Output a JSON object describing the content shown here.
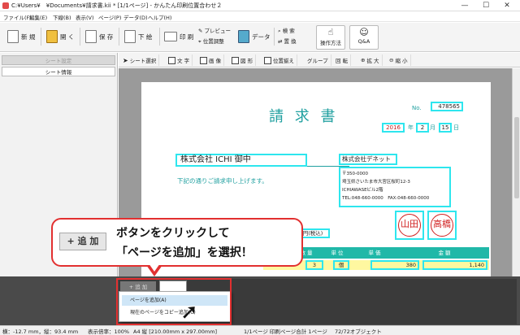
{
  "window": {
    "title": "C:¥Users¥　¥Documents¥請求書.kii * [1/1ページ] - かんたん印刷位置合わせ２",
    "controls": [
      "—",
      "☐",
      "✕"
    ]
  },
  "menu": [
    "ファイル(F)",
    "編集(E)",
    "下線(B)",
    "表示(V)",
    "ページ(P)",
    "データ(D)",
    "ヘルプ(H)"
  ],
  "toolbar": {
    "new": "新 規",
    "open": "開 く",
    "save": "保 存",
    "import": "下 絵",
    "print": "印 刷",
    "preview": "プレビュー",
    "position": "位置調整",
    "data": "データ",
    "search": "検 索",
    "replace": "置 換",
    "howto": "操作方法",
    "qa": "Q&A"
  },
  "leftPanel": {
    "tabs": [
      "シート設定",
      "シート情報"
    ]
  },
  "toolbar2": [
    "シート選択",
    "文 字",
    "画 像",
    "図 形",
    "位置揃え",
    "グループ",
    "回 転",
    "拡 大",
    "縮 小"
  ],
  "document": {
    "title": "請 求 書",
    "no_label": "No.",
    "no_value": "478565",
    "year": "2016",
    "year_unit": "年",
    "month": "2",
    "month_unit": "月",
    "day": "15",
    "day_unit": "日",
    "customer": "株式会社 ICHI 御中",
    "subtext": "下記の通りご請求申し上げます。",
    "company": "株式会社デネット",
    "address": [
      "〒350-0000",
      "埼玉県さいたま市大宮区桜町12-3",
      "ICHIAWASEビル2階",
      "TEL:048-660-0000　FAX:048-660-0000"
    ],
    "seal1": "山田",
    "seal2": "高橋",
    "tax_label": "円(税込)",
    "table_headers": [
      "数 量",
      "単 位",
      "単 価",
      "金 額"
    ],
    "row": {
      "qty": "3",
      "unit": "個",
      "price": "380",
      "amount": "1,140"
    }
  },
  "callout": {
    "button": "+ 追 加",
    "line1": "ボタンをクリックして",
    "line2": "「ページを追加」を選択！"
  },
  "bottom": {
    "add_button": "+ 追 加",
    "menu": [
      "ページを追加(A)",
      "現在のページをコピー追加(C)"
    ]
  },
  "status": {
    "coords": "横：-12.7 mm，縦：93.4 mm",
    "zoom": "表示倍率：100%",
    "paper": "A4 縦 [210.00mm x 297.00mm]",
    "page": "1/1ページ 印刷ページ合計 1ページ",
    "objects": "72/72オブジェクト"
  },
  "colors": {
    "accent_red": "#e23030",
    "cyan": "#2ee6ee",
    "table_header": "#20b8a8",
    "seal": "#d02020"
  }
}
